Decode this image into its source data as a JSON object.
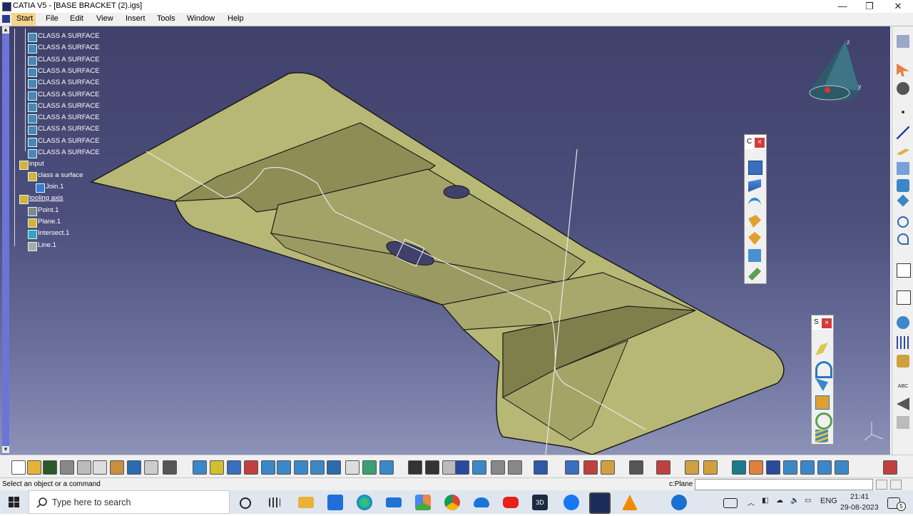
{
  "window": {
    "title": "CATIA V5 - [BASE BRACKET (2).igs]",
    "min": "—",
    "max": "❐",
    "close": "✕"
  },
  "menu": {
    "items": [
      "Start",
      "File",
      "Edit",
      "View",
      "Insert",
      "Tools",
      "Window",
      "Help"
    ]
  },
  "tree": {
    "surfaces": [
      "CLASS A SURFACE",
      "CLASS A SURFACE",
      "CLASS A SURFACE",
      "CLASS A SURFACE",
      "CLASS A SURFACE",
      "CLASS A SURFACE",
      "CLASS A SURFACE",
      "CLASS A SURFACE",
      "CLASS A SURFACE",
      "CLASS A SURFACE",
      "CLASS A SURFACE"
    ],
    "input": "input",
    "class_a": "class a surface",
    "join": "Join.1",
    "tooling_axis": "tooling axis",
    "point": "Point.1",
    "plane": "Plane.1",
    "intersect": "Intersect.1",
    "line": "Line.1"
  },
  "palettes": {
    "p1_title": "C",
    "p2_title": "S",
    "close": "×"
  },
  "compass": {
    "z": "z",
    "y": "y",
    "x": "x"
  },
  "status": {
    "message": "Select an object or a command",
    "command_label": "c:Plane",
    "command_value": ""
  },
  "taskbar": {
    "search_placeholder": "Type here to search",
    "lang": "ENG",
    "time": "21:41",
    "date": "29-08-2023",
    "notif_count": "5",
    "app_3d": "3D"
  },
  "colors": {
    "part": "#b6b673",
    "viewport_top": "#40416b",
    "viewport_bottom": "#8d92b8",
    "accent_red": "#d43b3b"
  }
}
